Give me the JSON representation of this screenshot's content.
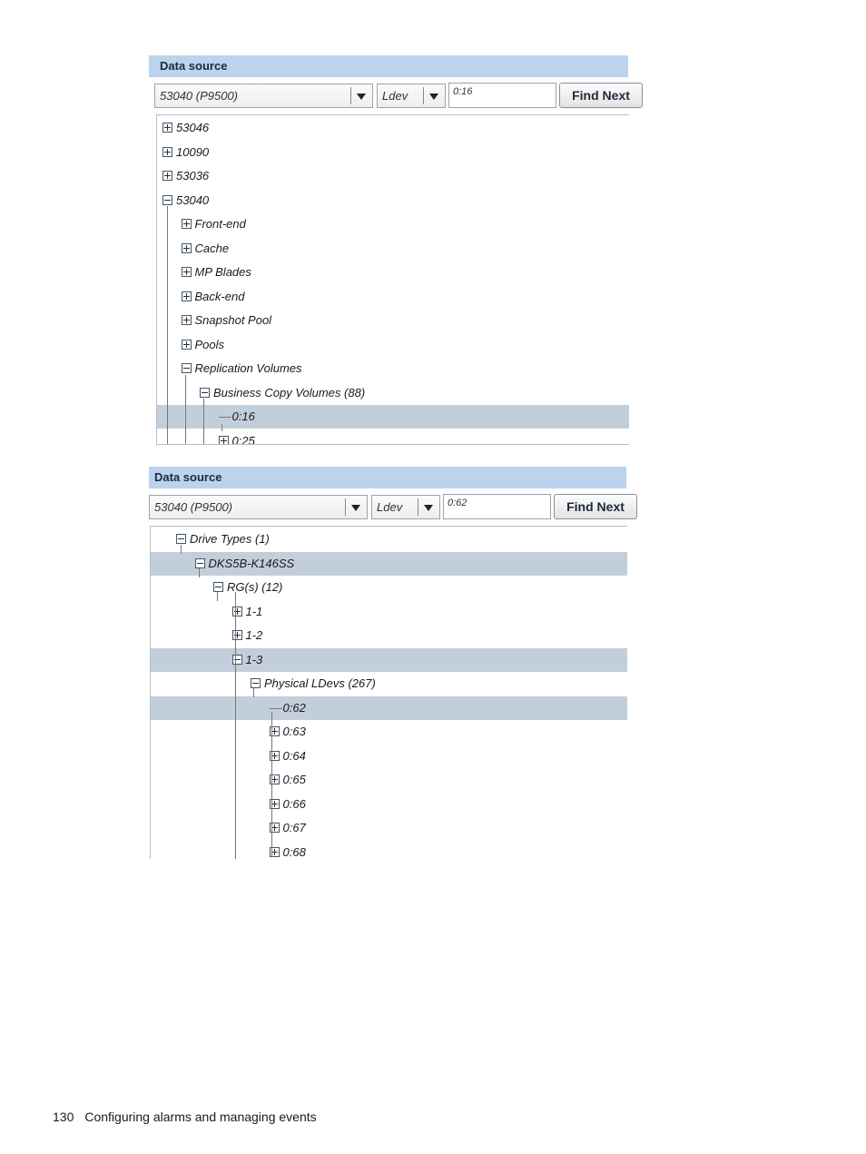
{
  "panel1": {
    "header": "Data source",
    "source_select": "53040  (P9500)",
    "type_select": "Ldev",
    "search_value": "0:16",
    "find_button": "Find Next",
    "tree": [
      {
        "label": "53046",
        "state": "collapsed",
        "level": 0
      },
      {
        "label": "10090",
        "state": "collapsed",
        "level": 0
      },
      {
        "label": "53036",
        "state": "collapsed",
        "level": 0
      },
      {
        "label": "53040",
        "state": "expanded",
        "level": 0
      },
      {
        "label": "Front-end",
        "state": "collapsed",
        "level": 1
      },
      {
        "label": "Cache",
        "state": "collapsed",
        "level": 1
      },
      {
        "label": "MP Blades",
        "state": "collapsed",
        "level": 1
      },
      {
        "label": "Back-end",
        "state": "collapsed",
        "level": 1
      },
      {
        "label": "Snapshot Pool",
        "state": "collapsed",
        "level": 1
      },
      {
        "label": "Pools",
        "state": "collapsed",
        "level": 1
      },
      {
        "label": "Replication Volumes",
        "state": "expanded",
        "level": 1
      },
      {
        "label": "Business Copy Volumes (88)",
        "state": "expanded",
        "level": 2
      },
      {
        "label": "0:16",
        "state": "leaf",
        "level": 3,
        "selected": true
      },
      {
        "label": "0:25",
        "state": "collapsed",
        "level": 3
      }
    ]
  },
  "panel2": {
    "header": "Data source",
    "source_select": "53040  (P9500)",
    "type_select": "Ldev",
    "search_value": "0:62",
    "find_button": "Find Next",
    "tree": [
      {
        "label": "Drive Types (1)",
        "state": "expanded",
        "level": 0
      },
      {
        "label": "DKS5B-K146SS",
        "state": "expanded",
        "level": 1,
        "selected": true
      },
      {
        "label": "RG(s) (12)",
        "state": "expanded",
        "level": 2
      },
      {
        "label": "1-1",
        "state": "collapsed",
        "level": 3
      },
      {
        "label": "1-2",
        "state": "collapsed",
        "level": 3
      },
      {
        "label": "1-3",
        "state": "expanded",
        "level": 3,
        "selected": true
      },
      {
        "label": "Physical LDevs (267)",
        "state": "expanded",
        "level": 4
      },
      {
        "label": "0:62",
        "state": "leaf",
        "level": 5,
        "selected": true
      },
      {
        "label": "0:63",
        "state": "collapsed",
        "level": 5
      },
      {
        "label": "0:64",
        "state": "collapsed",
        "level": 5
      },
      {
        "label": "0:65",
        "state": "collapsed",
        "level": 5
      },
      {
        "label": "0:66",
        "state": "collapsed",
        "level": 5
      },
      {
        "label": "0:67",
        "state": "collapsed",
        "level": 5
      },
      {
        "label": "0:68",
        "state": "collapsed",
        "level": 5
      }
    ]
  },
  "footer": {
    "page_number": "130",
    "section": "Configuring alarms and managing events"
  },
  "colors": {
    "header_bg": "#bcd3ee",
    "selected_row": "#c3cedb"
  }
}
